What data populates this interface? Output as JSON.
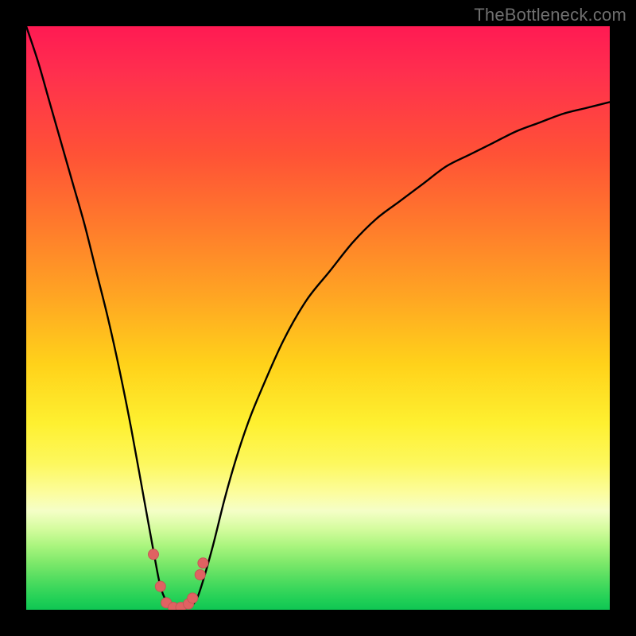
{
  "watermark": "TheBottleneck.com",
  "colors": {
    "frame": "#000000",
    "watermark": "#6f6f6f",
    "curve": "#000000",
    "marker_fill": "#e06262",
    "marker_stroke": "#c65757"
  },
  "chart_data": {
    "type": "line",
    "title": "",
    "xlabel": "",
    "ylabel": "",
    "xlim": [
      0,
      100
    ],
    "ylim": [
      0,
      100
    ],
    "x": [
      0,
      2,
      4,
      6,
      8,
      10,
      12,
      14,
      16,
      18,
      20,
      22,
      23,
      24,
      25,
      26,
      27,
      28,
      29,
      30,
      32,
      34,
      36,
      38,
      40,
      44,
      48,
      52,
      56,
      60,
      64,
      68,
      72,
      76,
      80,
      84,
      88,
      92,
      96,
      100
    ],
    "y": [
      100,
      94,
      87,
      80,
      73,
      66,
      58,
      50,
      41,
      31,
      20,
      9,
      4,
      1.5,
      0.5,
      0.3,
      0.3,
      0.5,
      1.5,
      4,
      11,
      19,
      26,
      32,
      37,
      46,
      53,
      58,
      63,
      67,
      70,
      73,
      76,
      78,
      80,
      82,
      83.5,
      85,
      86,
      87
    ],
    "markers": {
      "x": [
        21.8,
        23.0,
        24.0,
        25.2,
        26.5,
        27.8,
        28.5,
        29.8,
        30.3
      ],
      "y": [
        9.5,
        4.0,
        1.2,
        0.4,
        0.4,
        1.0,
        2.0,
        6.0,
        8.0
      ]
    },
    "gradient_stops": [
      {
        "pos": 0.0,
        "color": "#ff1a53"
      },
      {
        "pos": 0.22,
        "color": "#ff5236"
      },
      {
        "pos": 0.46,
        "color": "#ffa423"
      },
      {
        "pos": 0.68,
        "color": "#fef030"
      },
      {
        "pos": 0.83,
        "color": "#f5fec7"
      },
      {
        "pos": 1.0,
        "color": "#0fc653"
      }
    ]
  }
}
